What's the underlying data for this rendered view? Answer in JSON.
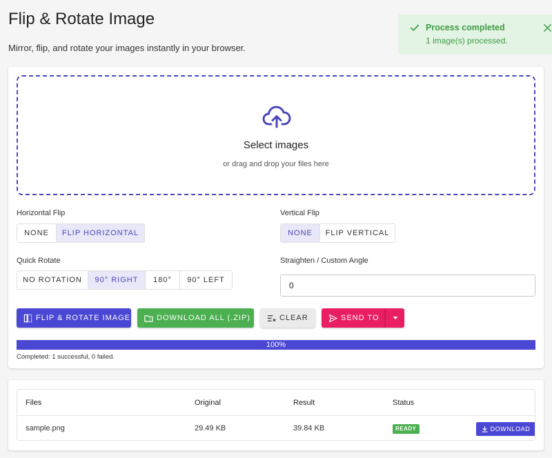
{
  "header": {
    "title": "Flip & Rotate Image",
    "subtitle": "Mirror, flip, and rotate your images instantly in your browser."
  },
  "toast": {
    "title": "Process completed",
    "message": "1 image(s) processed.",
    "color": "#3d9a45"
  },
  "dropzone": {
    "icon": "cloud-upload-icon",
    "title": "Select images",
    "subtitle": "or drag and drop your files here"
  },
  "horizontal_flip": {
    "label": "Horizontal Flip",
    "options": [
      "None",
      "Flip Horizontal"
    ],
    "selected": "Flip Horizontal"
  },
  "vertical_flip": {
    "label": "Vertical Flip",
    "options": [
      "None",
      "Flip Vertical"
    ],
    "selected": "None"
  },
  "quick_rotate": {
    "label": "Quick Rotate",
    "options": [
      "No Rotation",
      "90° Right",
      "180°",
      "90° Left"
    ],
    "selected": "90° Right"
  },
  "custom_angle": {
    "label": "Straighten / Custom Angle",
    "value": "0"
  },
  "actions": {
    "flip_rotate_label": "Flip & Rotate Image",
    "download_all_label": "Download All (.zip)",
    "clear_label": "Clear",
    "send_to_label": "Send To"
  },
  "progress": {
    "percent": 100,
    "label": "100%",
    "note": "Completed: 1 successful, 0 failed."
  },
  "files_table": {
    "columns": [
      "Files",
      "Original",
      "Result",
      "Status"
    ],
    "rows": [
      {
        "file": "sample.png",
        "original": "29.49 KB",
        "result": "39.84 KB",
        "status": "READY",
        "action": "Download"
      }
    ]
  },
  "colors": {
    "primary": "#4a47d4",
    "success": "#4caf50",
    "accent": "#e91e63",
    "background": "#f5f5f5"
  }
}
